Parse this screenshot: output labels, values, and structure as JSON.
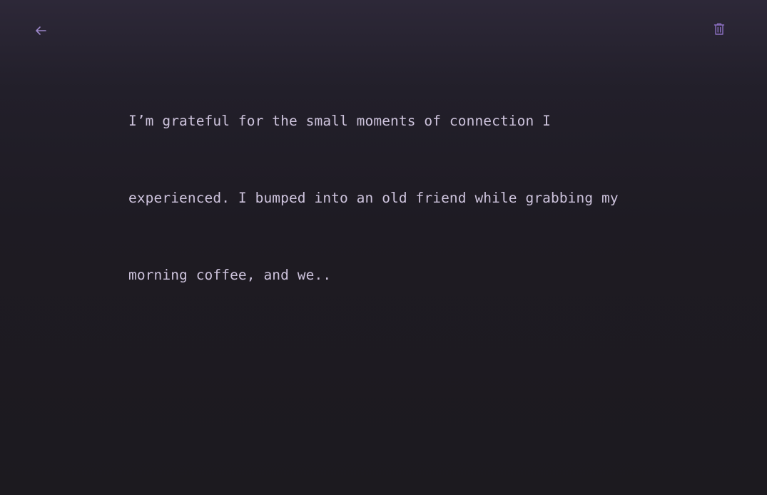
{
  "toolbar": {
    "back_icon": "arrow-left-icon",
    "delete_icon": "trash-icon",
    "icon_color": "#9a85c8",
    "delete_icon_color": "#8a6fc0"
  },
  "entry": {
    "lines": [
      "I’m grateful for the small moments of connection I",
      "experienced. I bumped into an old friend while grabbing my",
      "morning coffee, and we.."
    ],
    "text_color": "#cdc3dc"
  },
  "theme": {
    "background_top": "#2d2838",
    "background_bottom": "#1c1a1f"
  }
}
